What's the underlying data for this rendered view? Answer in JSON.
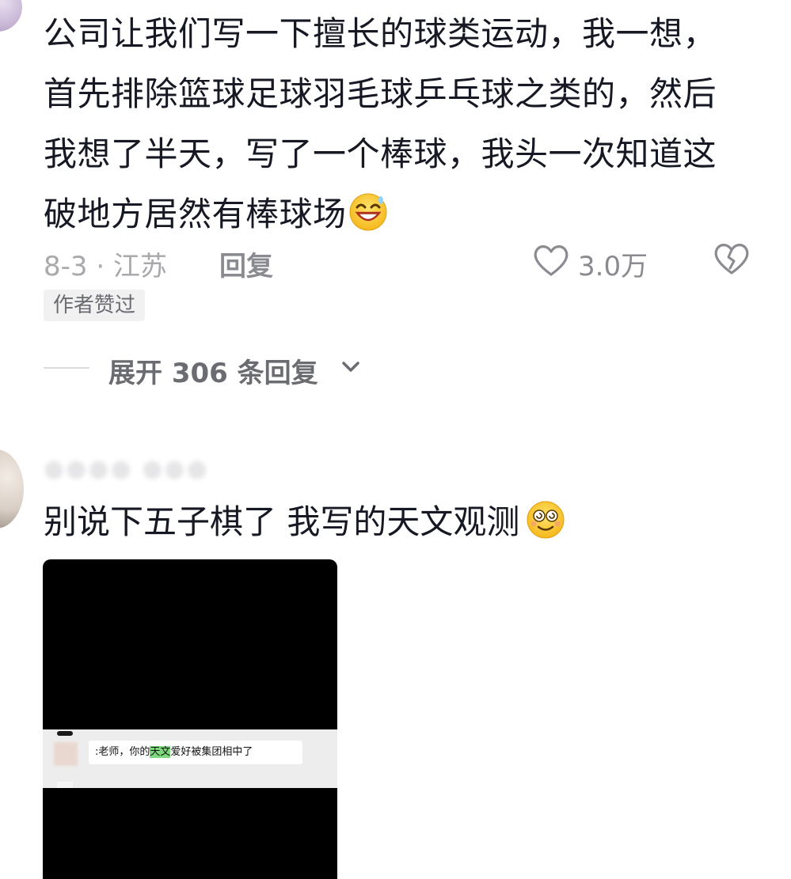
{
  "comment1": {
    "text": "公司让我们写一下擅长的球类运动，我一想，首先排除篮球足球羽毛球乒乓球之类的，然后我想了半天，写了一个棒球，我头一次知道这破地方居然有棒球场",
    "emoji": "grinning-sweat-emoji",
    "date_location": "8-3 · 江苏",
    "reply_label": "回复",
    "like_count": "3.0万",
    "author_badge": "作者赞过",
    "expand_replies": "展开 306 条回复"
  },
  "comment2": {
    "text": "别说下五子棋了 我写的天文观测",
    "emoji": "dizzy-smile-emoji",
    "image": {
      "chat_text_before": "老师，你的",
      "chat_text_highlight": "天文",
      "chat_text_after": "爱好被集团相中了"
    }
  },
  "colors": {
    "text_primary": "#161823",
    "text_secondary": "#8a8b91",
    "badge_bg": "#f1f1f2",
    "highlight": "#7bd97b"
  }
}
